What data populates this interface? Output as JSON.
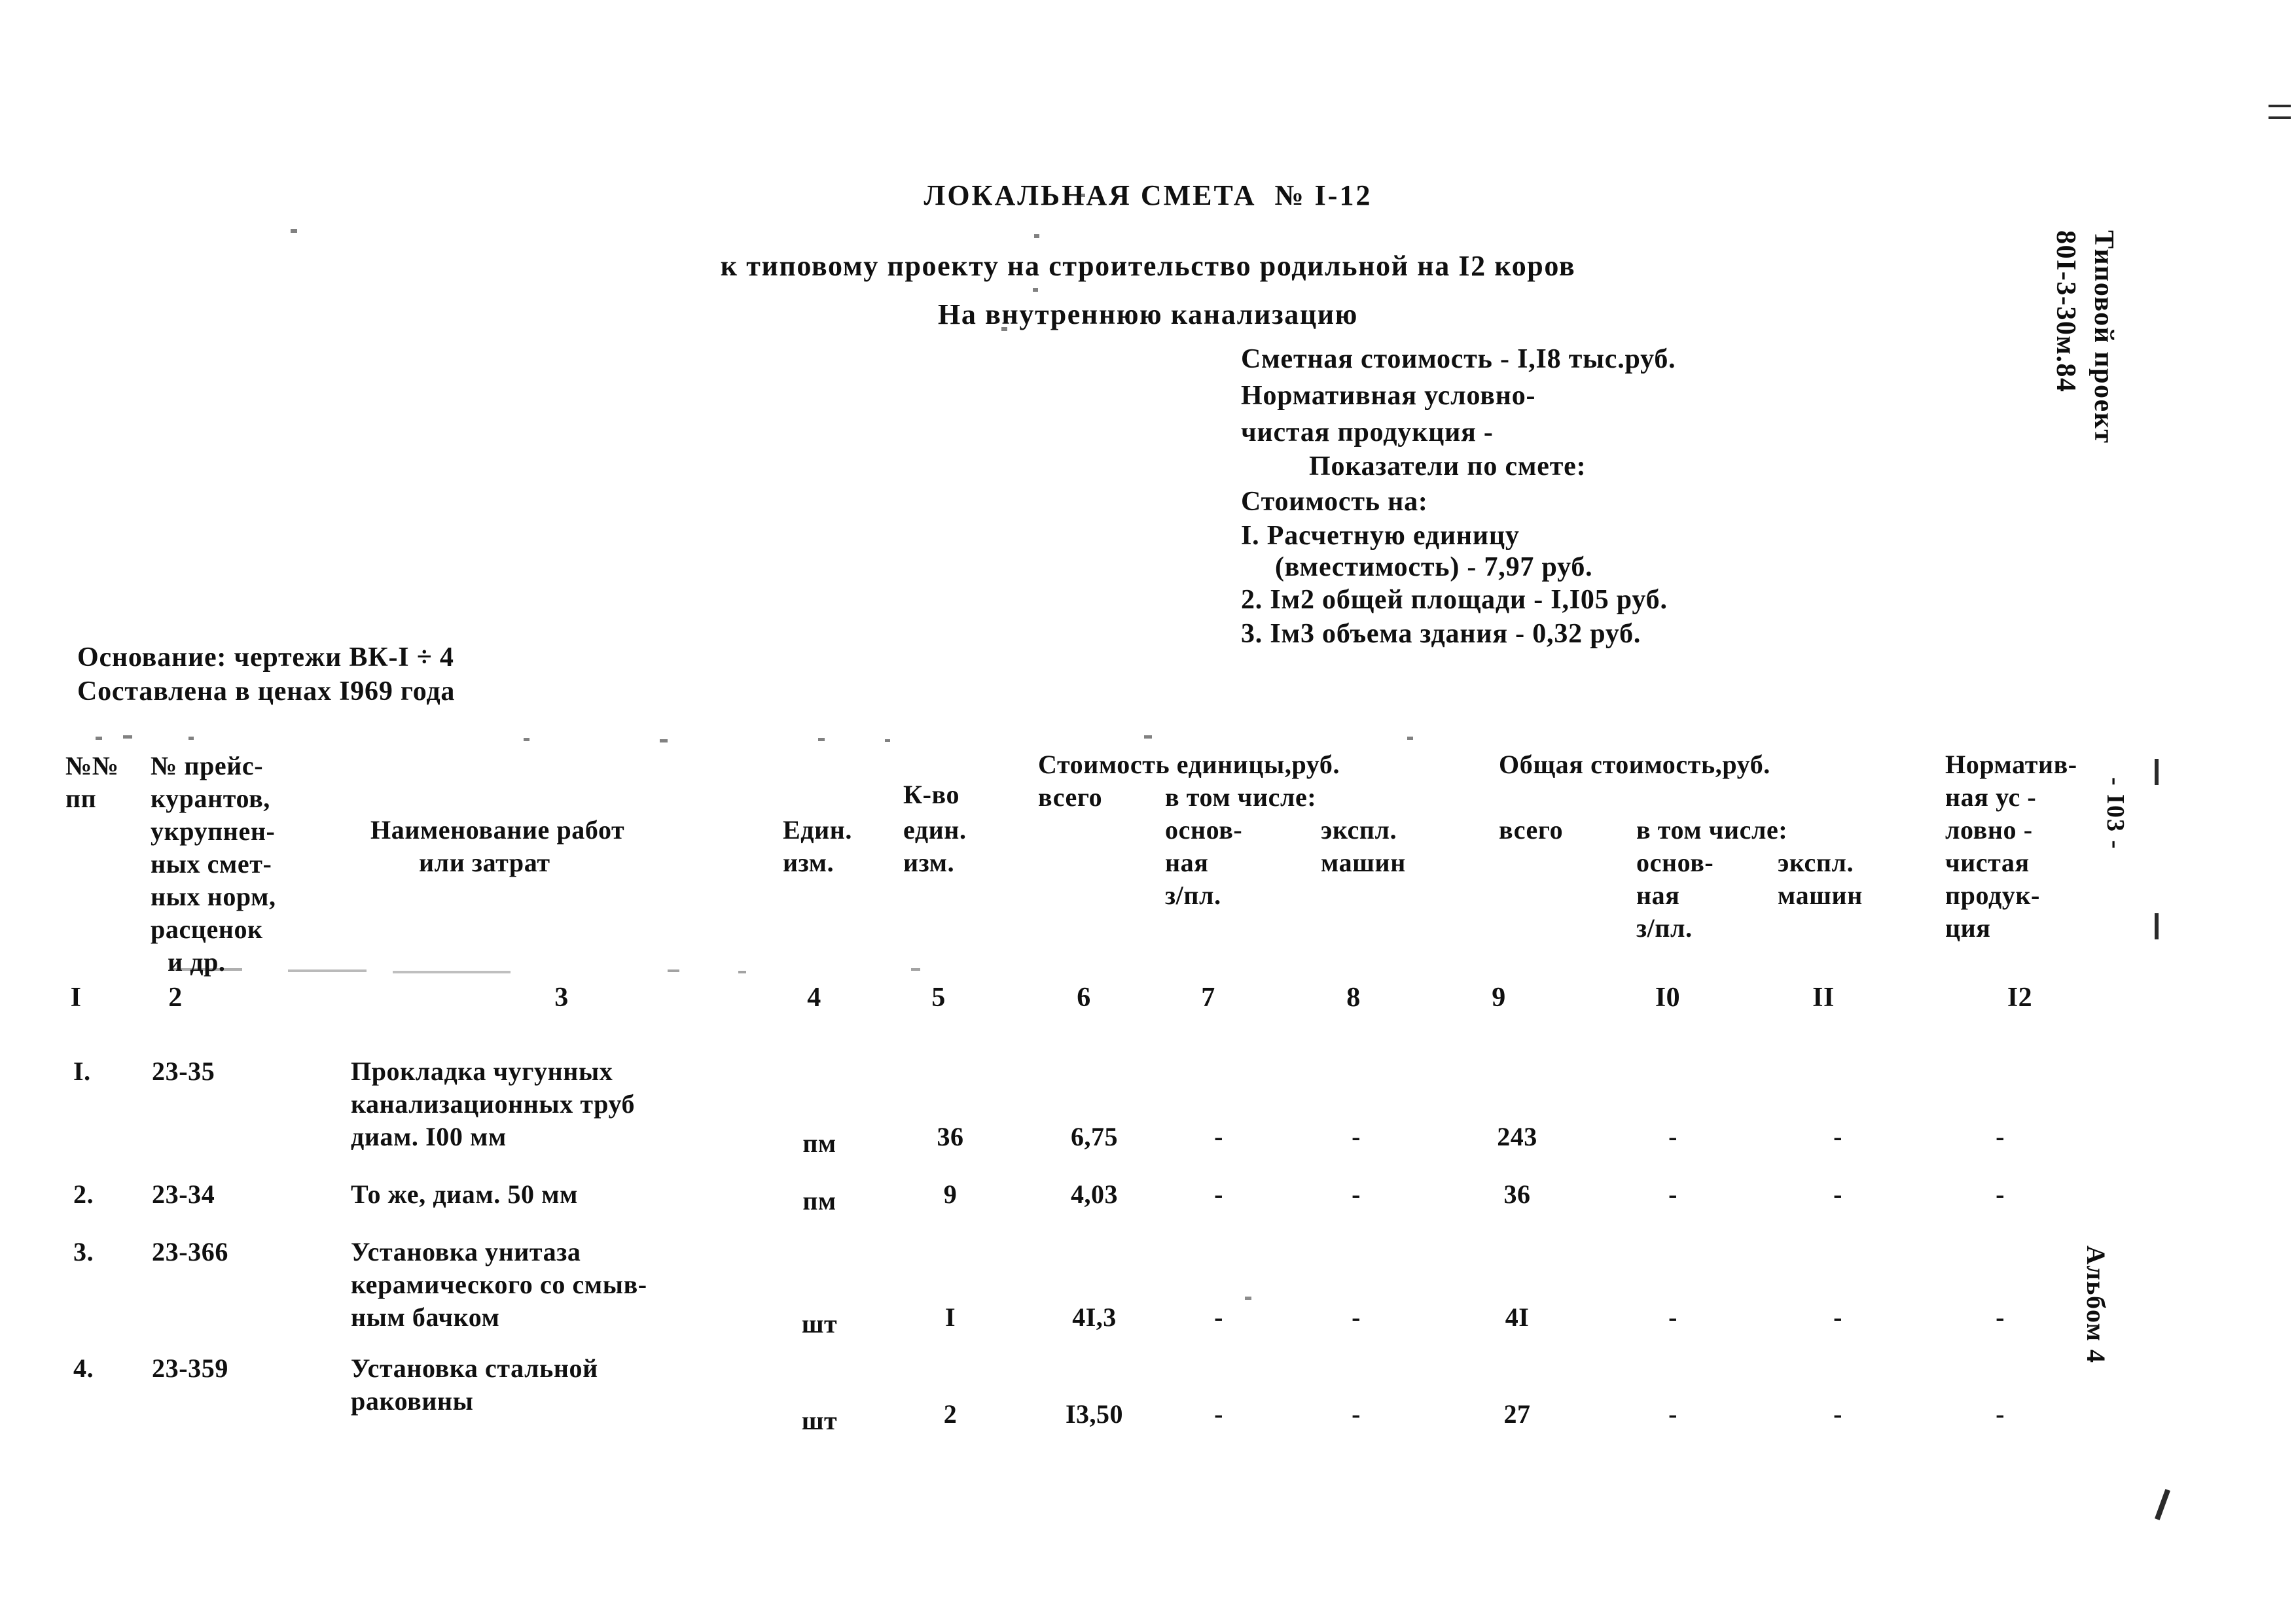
{
  "document": {
    "title": "ЛОКАЛЬНАЯ СМЕТА  № I-12",
    "subtitle_line1": "к типовому проекту на строительство родильной на I2 коров",
    "subtitle_line2": "На внутреннюю канализацию"
  },
  "summary": {
    "estimate_cost": "Сметная стоимость - I,I8 тыс.руб.",
    "npp_line1": "Нормативная условно-",
    "npp_line2": "чистая продукция -",
    "indicators_header": "Показатели по смете:",
    "cost_for": "Стоимость на:",
    "item1_line1": "I. Расчетную единицу",
    "item1_line2": "(вместимость) - 7,97 руб.",
    "item2": "2. Iм2 общей площади - I,I05 руб.",
    "item3": "3. Iм3 объема здания - 0,32 руб."
  },
  "basis": {
    "line1": "Основание: чертежи ВК-I ÷ 4",
    "line2": "Составлена в ценах I969 года"
  },
  "table": {
    "headers": {
      "col1_line1": "№№",
      "col1_line2": "пп",
      "col2_line1": "№ прейс-",
      "col2_line2": "курантов,",
      "col2_line3": "укрупнен-",
      "col2_line4": "ных смет-",
      "col2_line5": "ных норм,",
      "col2_line6": "расценок",
      "col2_line7": "и др.",
      "col3_line1": "Наименование работ",
      "col3_line2": "или затрат",
      "col4_line1": "Един.",
      "col4_line2": "изм.",
      "col5_line1": "К-во",
      "col5_line2": "един.",
      "col5_line3": "изм.",
      "group_unit_cost": "Стоимость единицы,руб.",
      "unit_total": "всего",
      "unit_inclusive": "в том числе:",
      "unit_basic_line1": "основ-",
      "unit_basic_line2": "ная",
      "unit_basic_line3": "з/пл.",
      "unit_mach_line1": "экспл.",
      "unit_mach_line2": "машин",
      "group_total_cost": "Общая стоимость,руб.",
      "total_total": "всего",
      "total_inclusive": "в том числе:",
      "total_basic_line1": "основ-",
      "total_basic_line2": "ная",
      "total_basic_line3": "з/пл.",
      "total_mach_line1": "экспл.",
      "total_mach_line2": "машин",
      "col12_line1": "Норматив-",
      "col12_line2": "ная ус -",
      "col12_line3": "ловно -",
      "col12_line4": "чистая",
      "col12_line5": "продук-",
      "col12_line6": "ция"
    },
    "column_numbers": [
      "I",
      "2",
      "3",
      "4",
      "5",
      "6",
      "7",
      "8",
      "9",
      "I0",
      "II",
      "I2"
    ],
    "rows": [
      {
        "no": "I.",
        "code": "23-35",
        "name_line1": "Прокладка чугунных",
        "name_line2": "канализационных труб",
        "name_line3": "диам. I00 мм",
        "unit": "пм",
        "qty": "36",
        "unit_total": "6,75",
        "unit_basic": "-",
        "unit_mach": "-",
        "total_total": "243",
        "total_basic": "-",
        "total_mach": "-",
        "npp": "-"
      },
      {
        "no": "2.",
        "code": "23-34",
        "name_line1": "То же, диам. 50 мм",
        "name_line2": "",
        "name_line3": "",
        "unit": "пм",
        "qty": "9",
        "unit_total": "4,03",
        "unit_basic": "-",
        "unit_mach": "-",
        "total_total": "36",
        "total_basic": "-",
        "total_mach": "-",
        "npp": "-"
      },
      {
        "no": "3.",
        "code": "23-366",
        "name_line1": "Установка унитаза",
        "name_line2": "керамического со смыв-",
        "name_line3": "ным бачком",
        "unit": "шт",
        "qty": "I",
        "unit_total": "4I,3",
        "unit_basic": "-",
        "unit_mach": "-",
        "total_total": "4I",
        "total_basic": "-",
        "total_mach": "-",
        "npp": "-"
      },
      {
        "no": "4.",
        "code": "23-359",
        "name_line1": "Установка стальной",
        "name_line2": "раковины",
        "name_line3": "",
        "unit": "шт",
        "qty": "2",
        "unit_total": "I3,50",
        "unit_basic": "-",
        "unit_mach": "-",
        "total_total": "27",
        "total_basic": "-",
        "total_mach": "-",
        "npp": "-"
      }
    ]
  },
  "margin": {
    "project_line1": "Типовой проект",
    "project_line2": "80I-3-30м.84",
    "album": "Альбом 4",
    "page_marker": "- I03 -"
  }
}
